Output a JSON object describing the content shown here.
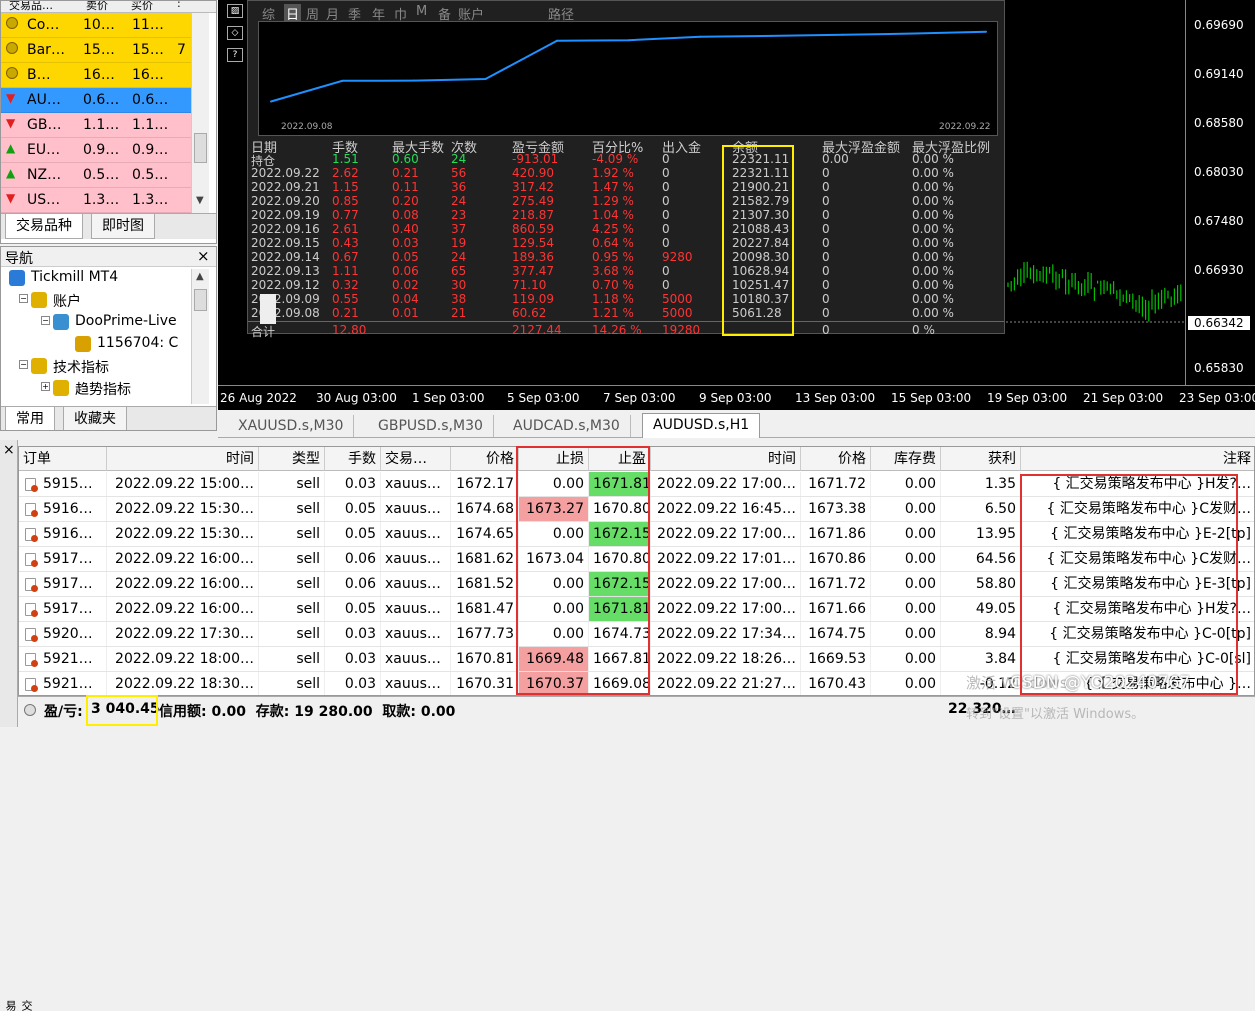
{
  "market_watch": {
    "headers": [
      "交易品…",
      "卖价",
      "买价",
      ":"
    ],
    "rows": [
      {
        "sym": "Co…",
        "bid": "10…",
        "ask": "11…",
        "extra": "",
        "bg": "#ffd700",
        "icon": "circle"
      },
      {
        "sym": "Bar…",
        "bid": "15…",
        "ask": "15…",
        "extra": "7",
        "bg": "#ffd700",
        "icon": "circle"
      },
      {
        "sym": "B…",
        "bid": "16…",
        "ask": "16…",
        "extra": "",
        "bg": "#ffd700",
        "icon": "circle"
      },
      {
        "sym": "AU…",
        "bid": "0.6…",
        "ask": "0.6…",
        "extra": "",
        "bg": "#3399ff",
        "icon": "down"
      },
      {
        "sym": "GB…",
        "bid": "1.1…",
        "ask": "1.1…",
        "extra": "",
        "bg": "#ffc0cb",
        "icon": "down"
      },
      {
        "sym": "EU…",
        "bid": "0.9…",
        "ask": "0.9…",
        "extra": "",
        "bg": "#ffc0cb",
        "icon": "up"
      },
      {
        "sym": "NZ…",
        "bid": "0.5…",
        "ask": "0.5…",
        "extra": "",
        "bg": "#ffc0cb",
        "icon": "up"
      },
      {
        "sym": "US…",
        "bid": "1.3…",
        "ask": "1.3…",
        "extra": "",
        "bg": "#ffc0cb",
        "icon": "down"
      }
    ],
    "tabs": [
      "交易品种",
      "即时图"
    ]
  },
  "navigator": {
    "title": "导航",
    "close": "×",
    "items": [
      {
        "label": "Tickmill MT4",
        "indent": 0,
        "icon": "terminal-icon"
      },
      {
        "label": "账户",
        "indent": 1,
        "icon": "accounts-icon"
      },
      {
        "label": "DooPrime-Live",
        "indent": 2,
        "icon": "server-icon"
      },
      {
        "label": "1156704: C",
        "indent": 3,
        "icon": "user-icon"
      },
      {
        "label": "技术指标",
        "indent": 1,
        "icon": "indicators-icon"
      },
      {
        "label": "趋势指标",
        "indent": 2,
        "icon": "indicators-icon"
      }
    ],
    "tabs": [
      "常用",
      "收藏夹"
    ]
  },
  "chart": {
    "price_labels": [
      "0.69690",
      "0.69140",
      "0.68580",
      "0.68030",
      "0.67480",
      "0.66930",
      "0.66342",
      "0.65830"
    ],
    "time_labels": [
      "26 Aug 2022",
      "30 Aug 03:00",
      "1 Sep 03:00",
      "5 Sep 03:00",
      "7 Sep 03:00",
      "9 Sep 03:00",
      "13 Sep 03:00",
      "15 Sep 03:00",
      "19 Sep 03:00",
      "21 Sep 03:00",
      "23 Sep 03:00"
    ],
    "report": {
      "toolbar": [
        "综",
        "日",
        "周",
        "月",
        "季",
        "年",
        "巾",
        "M",
        "备",
        "账户",
        "路径"
      ],
      "equity_x": [
        "2022.09.08",
        "2022.09.22"
      ],
      "equity_points": [
        5061.28,
        10180.37,
        10251.47,
        10628.94,
        20098.3,
        20227.84,
        21088.43,
        21307.3,
        21582.79,
        21900.21,
        22321.11
      ],
      "headers": [
        "日期",
        "手数",
        "最大手数",
        "次数",
        "盈亏金额",
        "百分比%",
        "出入金",
        "余额",
        "最大浮盈金额",
        "最大浮盈比例"
      ],
      "rows": [
        [
          "持仓",
          "1.51",
          "0.60",
          "24",
          "-913.01",
          "-4.09 %",
          "0",
          "22321.11",
          "0.00",
          "0.00 %"
        ],
        [
          "2022.09.22",
          "2.62",
          "0.21",
          "56",
          "420.90",
          "1.92 %",
          "0",
          "22321.11",
          "0",
          "0.00 %"
        ],
        [
          "2022.09.21",
          "1.15",
          "0.11",
          "36",
          "317.42",
          "1.47 %",
          "0",
          "21900.21",
          "0",
          "0.00 %"
        ],
        [
          "2022.09.20",
          "0.85",
          "0.20",
          "24",
          "275.49",
          "1.29 %",
          "0",
          "21582.79",
          "0",
          "0.00 %"
        ],
        [
          "2022.09.19",
          "0.77",
          "0.08",
          "23",
          "218.87",
          "1.04 %",
          "0",
          "21307.30",
          "0",
          "0.00 %"
        ],
        [
          "2022.09.16",
          "2.61",
          "0.40",
          "37",
          "860.59",
          "4.25 %",
          "0",
          "21088.43",
          "0",
          "0.00 %"
        ],
        [
          "2022.09.15",
          "0.43",
          "0.03",
          "19",
          "129.54",
          "0.64 %",
          "0",
          "20227.84",
          "0",
          "0.00 %"
        ],
        [
          "2022.09.14",
          "0.67",
          "0.05",
          "24",
          "189.36",
          "0.95 %",
          "9280",
          "20098.30",
          "0",
          "0.00 %"
        ],
        [
          "2022.09.13",
          "1.11",
          "0.06",
          "65",
          "377.47",
          "3.68 %",
          "0",
          "10628.94",
          "0",
          "0.00 %"
        ],
        [
          "2022.09.12",
          "0.32",
          "0.02",
          "30",
          "71.10",
          "0.70 %",
          "0",
          "10251.47",
          "0",
          "0.00 %"
        ],
        [
          "2022.09.09",
          "0.55",
          "0.04",
          "38",
          "119.09",
          "1.18 %",
          "5000",
          "10180.37",
          "0",
          "0.00 %"
        ],
        [
          "2022.09.08",
          "0.21",
          "0.01",
          "21",
          "60.62",
          "1.21 %",
          "5000",
          "5061.28",
          "0",
          "0.00 %"
        ]
      ],
      "total": [
        "合计",
        "12.80",
        "",
        "",
        "2127.44",
        "14.26 %",
        "19280",
        "",
        "0",
        "0 %"
      ]
    }
  },
  "chart_tabs": [
    "XAUUSD.s,M30",
    "GBPUSD.s,M30",
    "AUDCAD.s,M30",
    "AUDUSD.s,H1"
  ],
  "terminal": {
    "headers": [
      "订单",
      "时间",
      "类型",
      "手数",
      "交易…",
      "价格",
      "止损",
      "止盈",
      "时间",
      "价格",
      "库存费",
      "获利",
      "注释"
    ],
    "rows": [
      [
        "5915…",
        "2022.09.22 15:00…",
        "sell",
        "0.03",
        "xauus…",
        "1672.17",
        "0.00",
        "1671.81",
        "2022.09.22 17:00…",
        "1671.72",
        "0.00",
        "1.35",
        "{ 汇交易策略发布中心 }H发?…"
      ],
      [
        "5916…",
        "2022.09.22 15:30…",
        "sell",
        "0.05",
        "xauus…",
        "1674.68",
        "1673.27",
        "1670.80",
        "2022.09.22 16:45…",
        "1673.38",
        "0.00",
        "6.50",
        "{ 汇交易策略发布中心 }C发财…"
      ],
      [
        "5916…",
        "2022.09.22 15:30…",
        "sell",
        "0.05",
        "xauus…",
        "1674.65",
        "0.00",
        "1672.15",
        "2022.09.22 17:00…",
        "1671.86",
        "0.00",
        "13.95",
        "{ 汇交易策略发布中心 }E-2[tp]"
      ],
      [
        "5917…",
        "2022.09.22 16:00…",
        "sell",
        "0.06",
        "xauus…",
        "1681.62",
        "1673.04",
        "1670.80",
        "2022.09.22 17:01…",
        "1670.86",
        "0.00",
        "64.56",
        "{ 汇交易策略发布中心 }C发财…"
      ],
      [
        "5917…",
        "2022.09.22 16:00…",
        "sell",
        "0.06",
        "xauus…",
        "1681.52",
        "0.00",
        "1672.15",
        "2022.09.22 17:00…",
        "1671.72",
        "0.00",
        "58.80",
        "{ 汇交易策略发布中心 }E-3[tp]"
      ],
      [
        "5917…",
        "2022.09.22 16:00…",
        "sell",
        "0.05",
        "xauus…",
        "1681.47",
        "0.00",
        "1671.81",
        "2022.09.22 17:00…",
        "1671.66",
        "0.00",
        "49.05",
        "{ 汇交易策略发布中心 }H发?…"
      ],
      [
        "5920…",
        "2022.09.22 17:30…",
        "sell",
        "0.03",
        "xauus…",
        "1677.73",
        "0.00",
        "1674.73",
        "2022.09.22 17:34…",
        "1674.75",
        "0.00",
        "8.94",
        "{ 汇交易策略发布中心 }C-0[tp]"
      ],
      [
        "5921…",
        "2022.09.22 18:00…",
        "sell",
        "0.03",
        "xauus…",
        "1670.81",
        "1669.48",
        "1667.81",
        "2022.09.22 18:26…",
        "1669.53",
        "0.00",
        "3.84",
        "{ 汇交易策略发布中心 }C-0[sl]"
      ],
      [
        "5921…",
        "2022.09.22 18:30…",
        "sell",
        "0.03",
        "xauus…",
        "1670.31",
        "1670.37",
        "1669.08",
        "2022.09.22 21:27…",
        "1670.43",
        "0.00",
        "-0.12",
        "{ 汇交易策略发布中心 }…"
      ]
    ],
    "sl_hl": [
      false,
      true,
      false,
      false,
      false,
      false,
      false,
      true,
      true
    ],
    "tp_hl": [
      true,
      false,
      true,
      false,
      true,
      true,
      false,
      false,
      false
    ],
    "side_label": "交易",
    "close": "×"
  },
  "status": {
    "pl_label": "盈/亏:",
    "pl_value": "3 040.45",
    "rest": "信用额: 0.00  存款: 19 280.00  取款: 0.00",
    "right": "22 320…",
    "watermark": "激活 Windows",
    "watermark2": "转到\"设置\"以激活 Windows。",
    "csdn": "CSDN @YO20240767"
  },
  "colors": {
    "green": "#00cc44",
    "red": "#ff3333",
    "yellow_box": "#ffee00",
    "red_box": "#e03030",
    "sl_hl": "#f4a0a0",
    "tp_hl": "#66dd66"
  }
}
